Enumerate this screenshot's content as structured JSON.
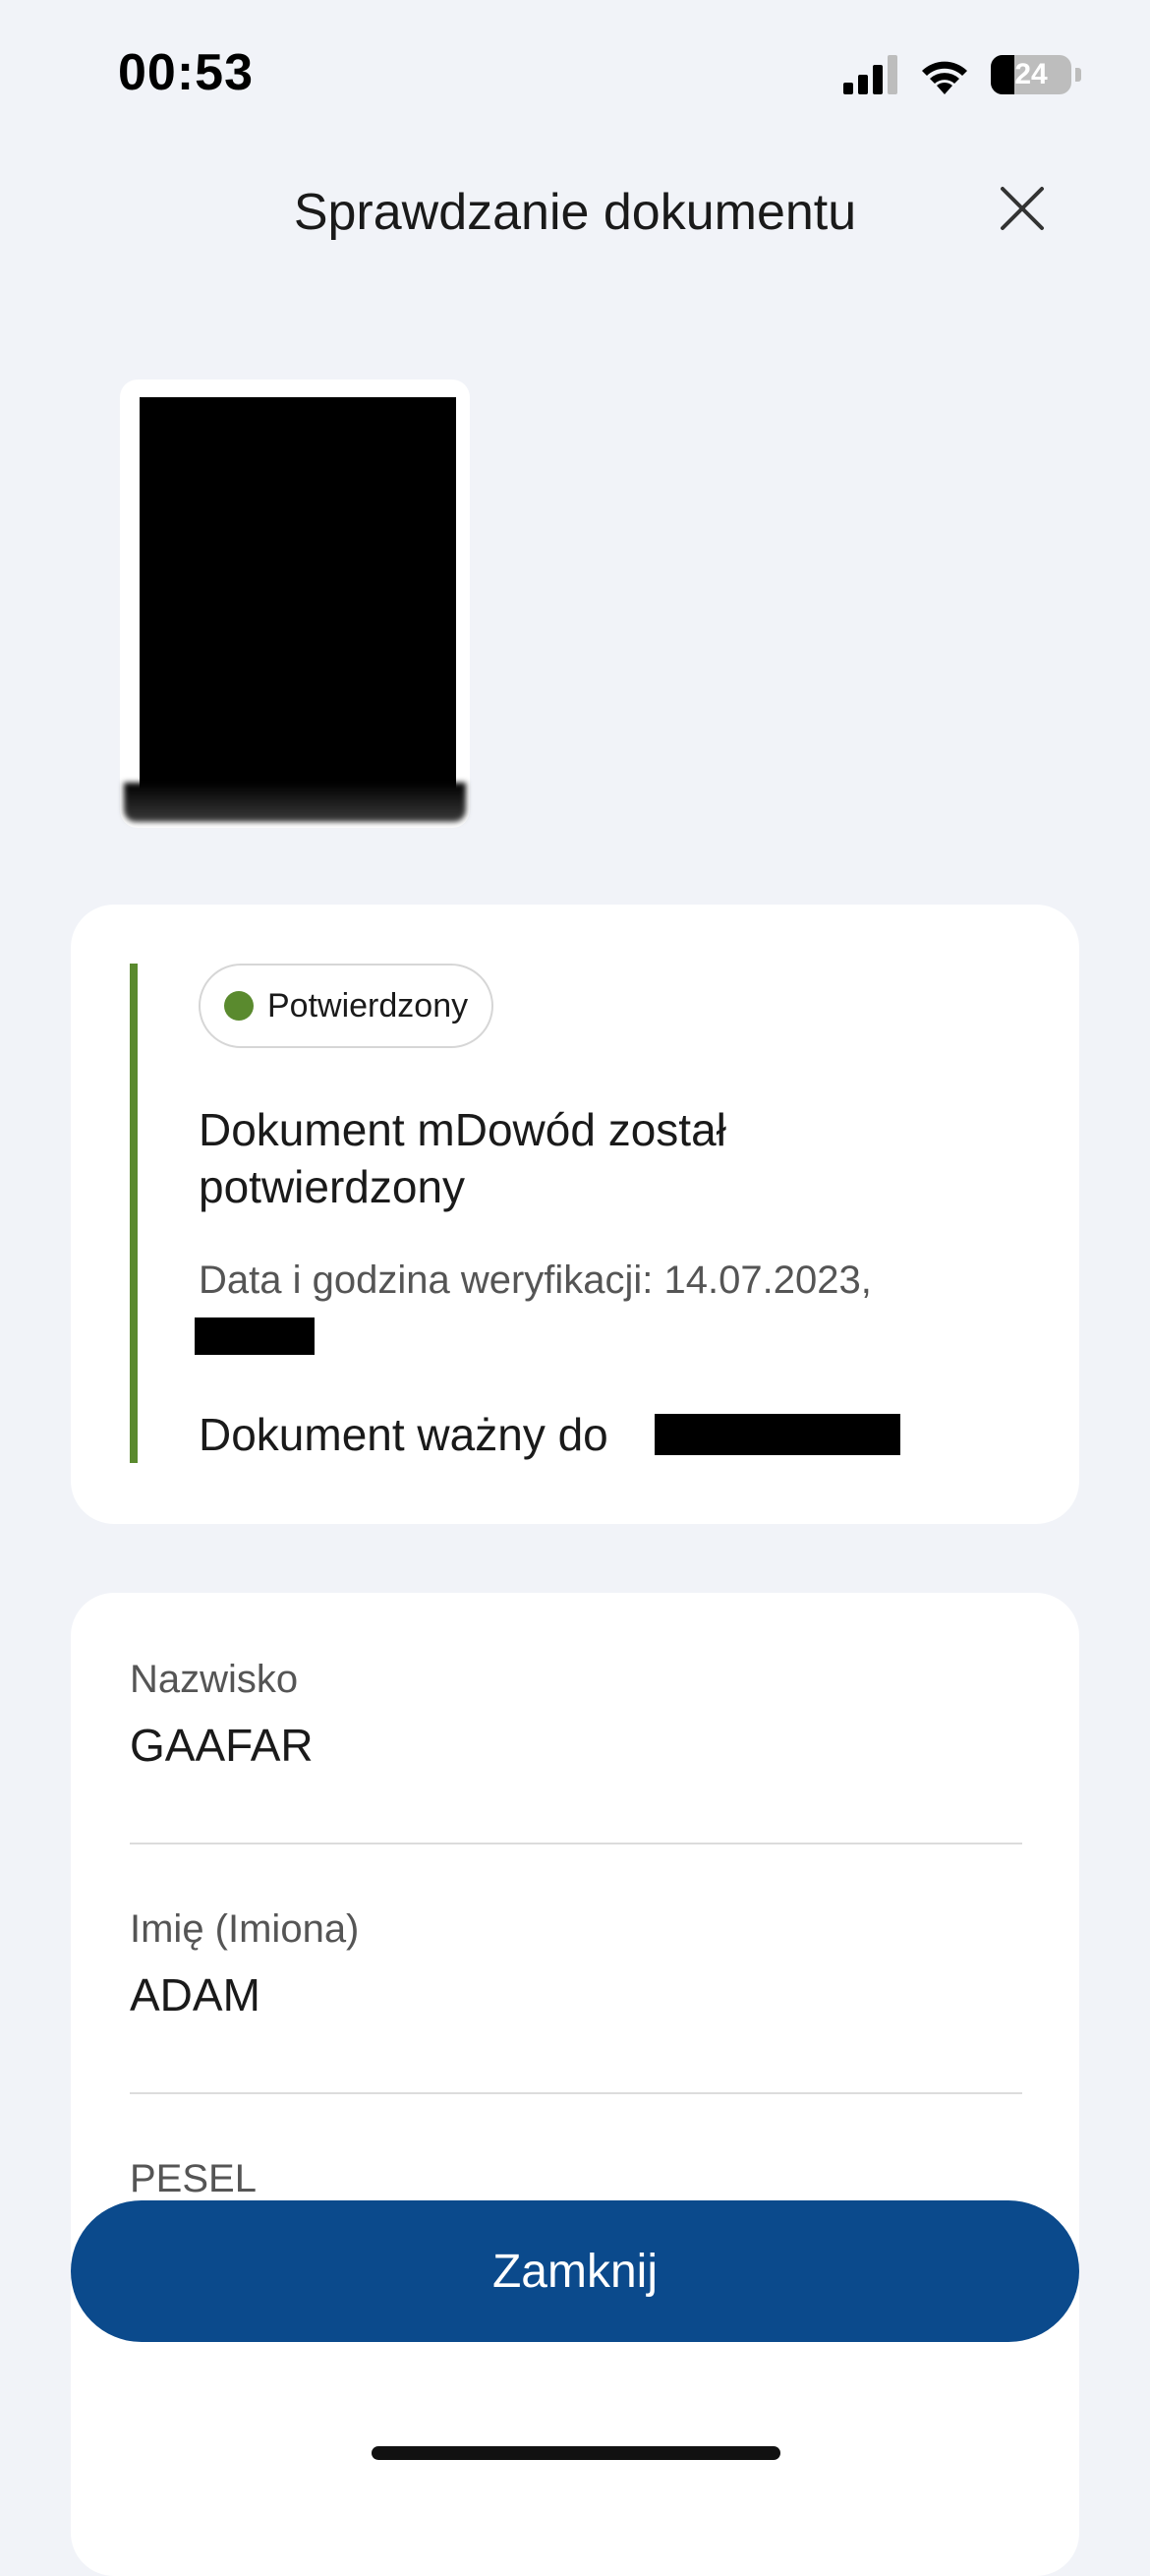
{
  "status_bar": {
    "time": "00:53",
    "battery": "24"
  },
  "header": {
    "title": "Sprawdzanie dokumentu"
  },
  "status_card": {
    "badge": "Potwierdzony",
    "heading": "Dokument mDowód został potwierdzony",
    "verification_text": "Data i godzina weryfikacji: 14.07.2023,",
    "valid_until_text": "Dokument ważny do"
  },
  "fields": [
    {
      "label": "Nazwisko",
      "value": "GAAFAR"
    },
    {
      "label": "Imię (Imiona)",
      "value": "ADAM"
    },
    {
      "label": "PESEL",
      "value": ""
    }
  ],
  "footer": {
    "button_label": "Zamknij"
  },
  "colors": {
    "accent": "#0b4a8c",
    "success": "#5a8a2e",
    "background": "#f1f3f8"
  }
}
